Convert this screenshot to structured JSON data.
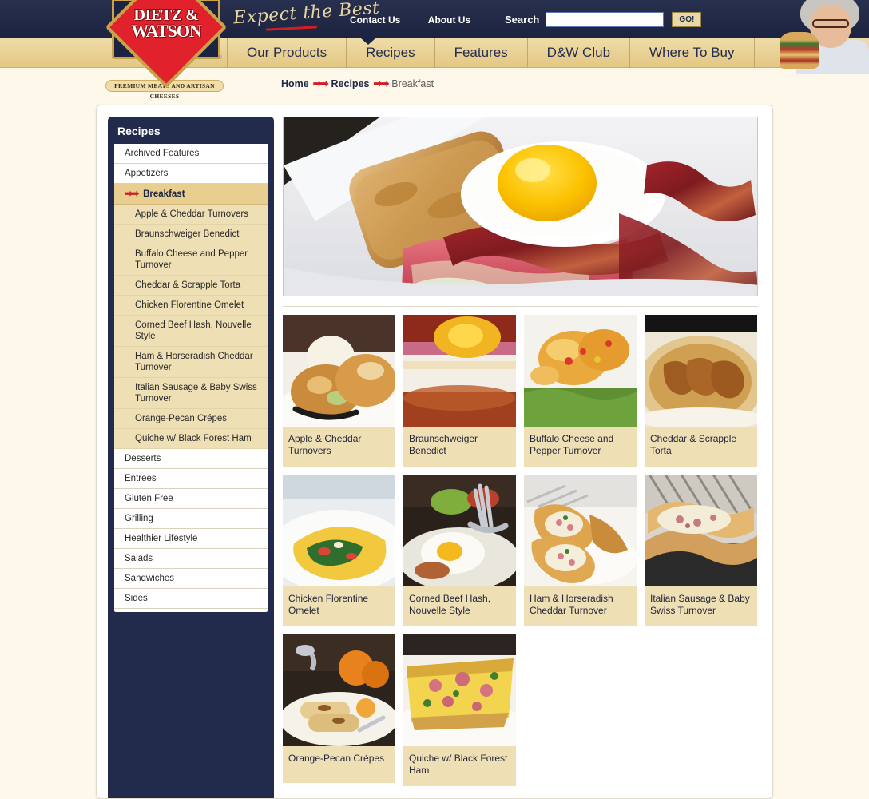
{
  "site": {
    "logo_line1": "DIETZ &",
    "logo_line2": "WATSON",
    "logo_registered": "®",
    "tagline": "Expect the Best",
    "premium_badge": "Premium Meats and Artisan Cheeses"
  },
  "header": {
    "top_links": [
      {
        "label": "Contact Us",
        "name": "contact-us-link"
      },
      {
        "label": "About Us",
        "name": "about-us-link"
      }
    ],
    "search": {
      "label": "Search",
      "value": "",
      "placeholder": "",
      "button_label": "GO!"
    }
  },
  "nav": {
    "items": [
      {
        "label": "Our Products",
        "active": false
      },
      {
        "label": "Recipes",
        "active": true
      },
      {
        "label": "Features",
        "active": false
      },
      {
        "label": "D&W Club",
        "active": false
      },
      {
        "label": "Where To Buy",
        "active": false
      }
    ]
  },
  "breadcrumb": {
    "arrow": "➡➡",
    "items": [
      "Home",
      "Recipes"
    ],
    "current": "Breakfast"
  },
  "sidebar": {
    "title": "Recipes",
    "items": [
      {
        "label": "Archived Features",
        "active": false
      },
      {
        "label": "Appetizers",
        "active": false
      },
      {
        "label": "Breakfast",
        "active": true
      },
      {
        "label": "Desserts",
        "active": false
      },
      {
        "label": "Entrees",
        "active": false
      },
      {
        "label": "Gluten Free",
        "active": false
      },
      {
        "label": "Grilling",
        "active": false
      },
      {
        "label": "Healthier Lifestyle",
        "active": false
      },
      {
        "label": "Salads",
        "active": false
      },
      {
        "label": "Sandwiches",
        "active": false
      },
      {
        "label": "Sides",
        "active": false
      }
    ],
    "sub_items": [
      "Apple & Cheddar Turnovers",
      "Braunschweiger Benedict",
      "Buffalo Cheese and Pepper Turnover",
      "Cheddar & Scrapple Torta",
      "Chicken Florentine Omelet",
      "Corned Beef Hash, Nouvelle Style",
      "Ham & Horseradish Cheddar Turnover",
      "Italian Sausage & Baby Swiss Turnover",
      "Orange-Pecan Crépes",
      "Quiche w/ Black Forest Ham"
    ]
  },
  "main": {
    "hero_alt": "breakfast-sandwich-with-fried-egg-bacon-and-pancakes",
    "cards": [
      {
        "title": "Apple & Cheddar Turnovers",
        "image_alt": "apple-cheddar-turnovers-with-ice-cream"
      },
      {
        "title": "Braunschweiger Benedict",
        "image_alt": "braunschweiger-benedict-with-egg"
      },
      {
        "title": "Buffalo Cheese and Pepper Turnover",
        "image_alt": "buffalo-cheese-pepper-turnovers-on-greens"
      },
      {
        "title": "Cheddar & Scrapple Torta",
        "image_alt": "cheddar-scrapple-torta-pie"
      },
      {
        "title": "Chicken Florentine Omelet",
        "image_alt": "chicken-florentine-omelet-with-spinach"
      },
      {
        "title": "Corned Beef Hash, Nouvelle Style",
        "image_alt": "corned-beef-hash-with-poached-egg-and-fork"
      },
      {
        "title": "Ham & Horseradish Cheddar Turnover",
        "image_alt": "ham-horseradish-cheddar-turnovers"
      },
      {
        "title": "Italian Sausage & Baby Swiss Turnover",
        "image_alt": "italian-sausage-baby-swiss-turnover"
      },
      {
        "title": "Orange-Pecan Crépes",
        "image_alt": "orange-pecan-crepes-on-plate-with-oranges"
      },
      {
        "title": "Quiche w/ Black Forest Ham",
        "image_alt": "quiche-with-black-forest-ham-slice"
      }
    ]
  },
  "colors": {
    "navy": "#222b4c",
    "gold": "#e8cf8f",
    "gold_light": "#eedfb5",
    "red": "#cf1f26",
    "page_bg": "#fdf8ea"
  }
}
